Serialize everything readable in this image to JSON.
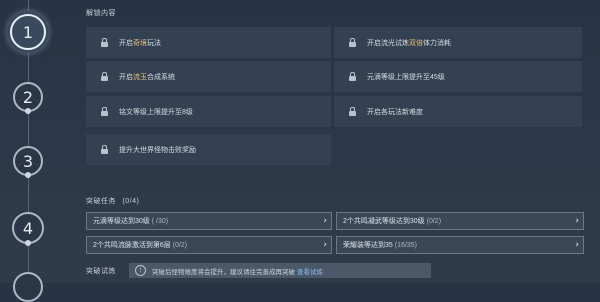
{
  "rail": {
    "nodes": [
      "1",
      "2",
      "3",
      "4"
    ]
  },
  "unlock": {
    "title": "解锁内容",
    "items": [
      {
        "pre": "开启",
        "hl": "奇境",
        "post": "玩法"
      },
      {
        "pre": "开启流光试炼",
        "hl": "双倍",
        "post": "体力消耗"
      },
      {
        "pre": "开启",
        "hl": "流玉",
        "post": "合成系统"
      },
      {
        "pre": "元滴等级上限提升至45级",
        "hl": "",
        "post": ""
      },
      {
        "pre": "铭文等级上限提升至8级",
        "hl": "",
        "post": ""
      },
      {
        "pre": "开启各玩法新难度",
        "hl": "",
        "post": ""
      },
      {
        "pre": "提升大世界怪物击败奖励",
        "hl": "",
        "post": ""
      }
    ]
  },
  "tasks": {
    "title": "突破任务",
    "count": "(0/4)",
    "items": [
      {
        "label": "元滴等级达到30级",
        "progress": "( /30)"
      },
      {
        "label": "2个共鸣凝武等级达到30级",
        "progress": "(0/2)"
      },
      {
        "label": "2个共鸣流脉激活到第6层",
        "progress": "(0/2)"
      },
      {
        "label": "荣耀装等达到35",
        "progress": "(16/35)"
      }
    ]
  },
  "trial": {
    "title": "突破试炼",
    "hint": "突破后怪物难度将会提升，建议请往完善成再突破",
    "link": "查看试炼"
  }
}
